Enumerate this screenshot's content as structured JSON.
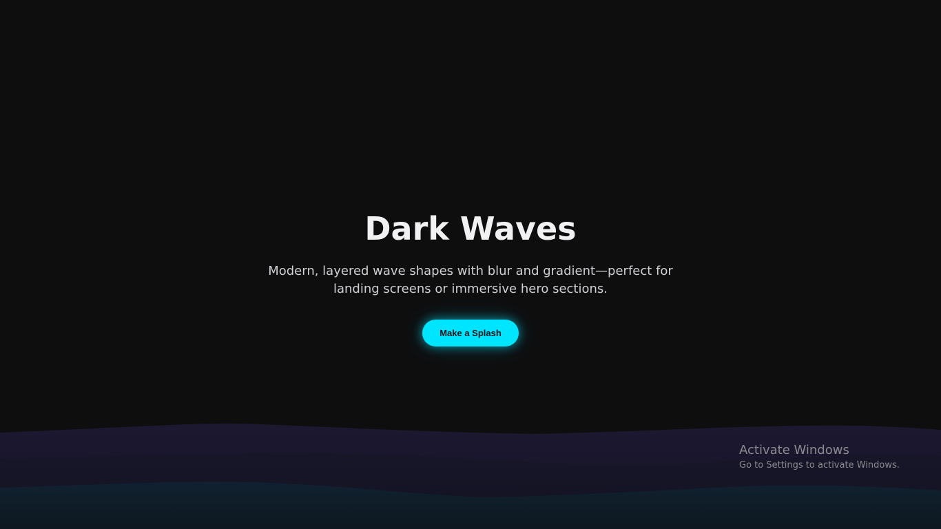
{
  "hero": {
    "title": "Dark Waves",
    "subtitle": "Modern, layered wave shapes with blur and gradient—perfect for landing screens or immersive hero sections.",
    "cta_label": "Make a Splash"
  },
  "theme": {
    "background": "#0e0e0f",
    "accent": "#00e5ff",
    "wave_colors": [
      "#1a1628",
      "#16152a",
      "#0f1d26"
    ]
  },
  "watermark": {
    "title": "Activate Windows",
    "subtitle": "Go to Settings to activate Windows."
  }
}
